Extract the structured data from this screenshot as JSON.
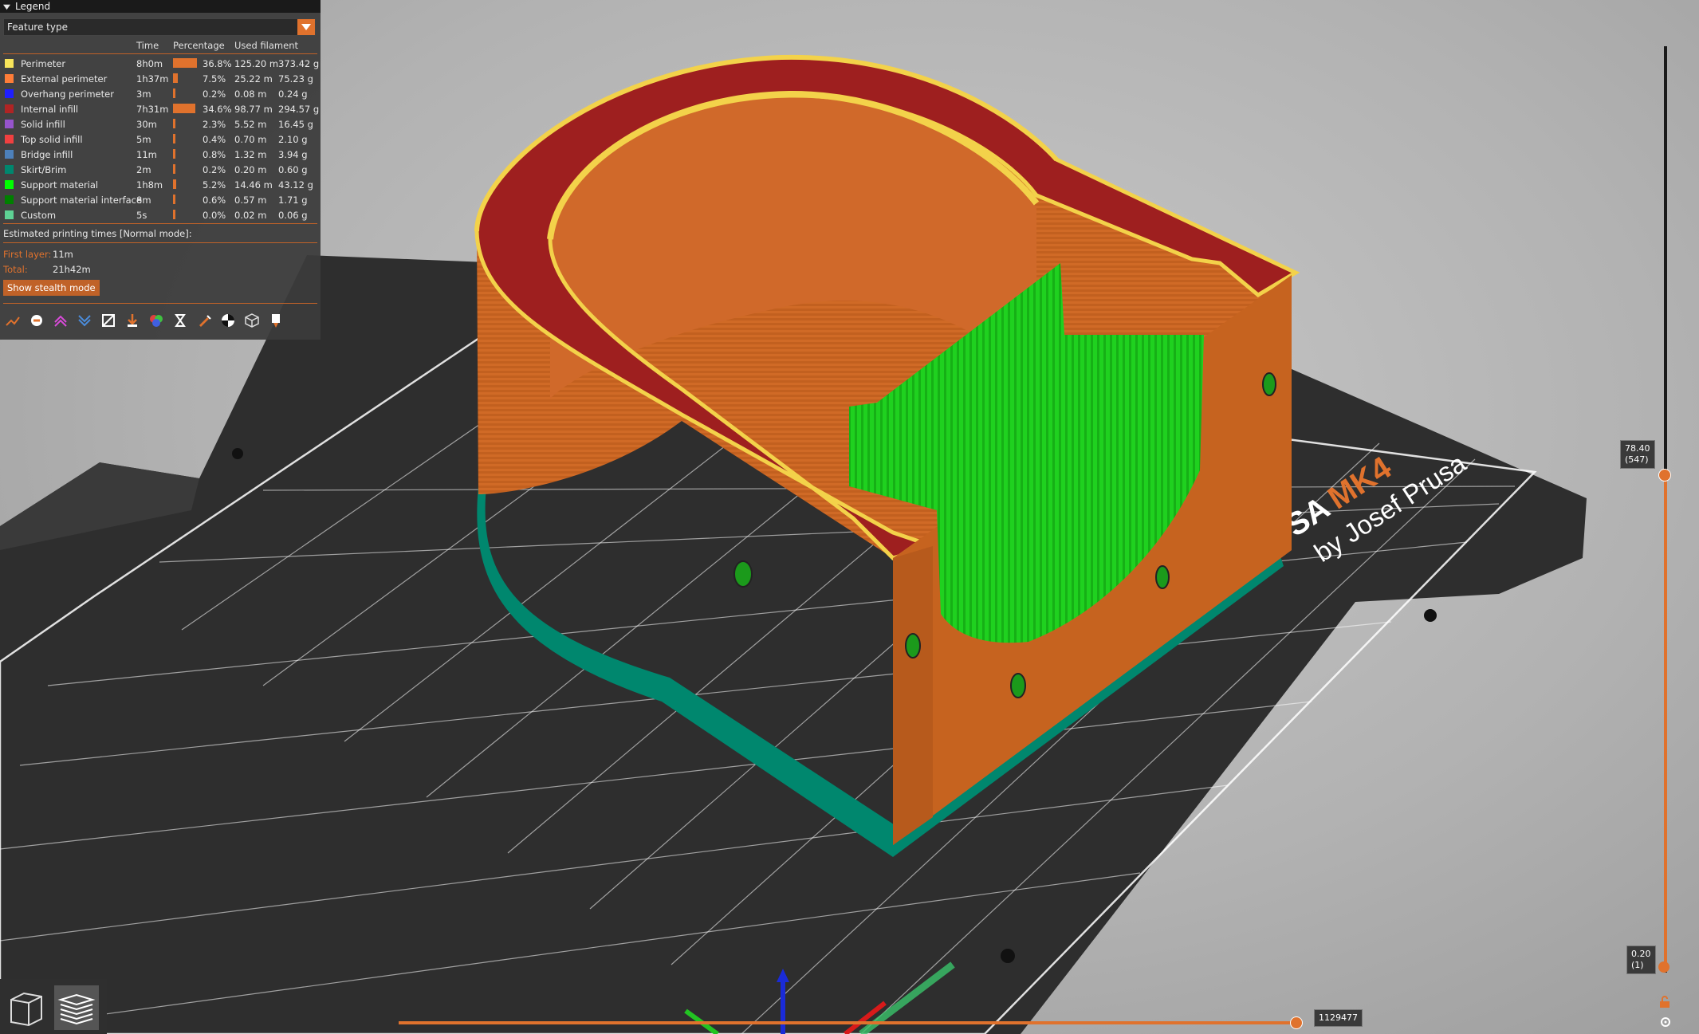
{
  "legend": {
    "title": "Legend",
    "view_type": "Feature type",
    "columns": {
      "time": "Time",
      "percentage": "Percentage",
      "used_filament": "Used filament"
    },
    "rows": [
      {
        "name": "Perimeter",
        "color": "#f7e45a",
        "time": "8h0m",
        "pct": "36.8%",
        "pct_value": 36.8,
        "length": "125.20 m",
        "weight": "373.42 g"
      },
      {
        "name": "External perimeter",
        "color": "#ff7d38",
        "time": "1h37m",
        "pct": "7.5%",
        "pct_value": 7.5,
        "length": "25.22 m",
        "weight": "75.23 g"
      },
      {
        "name": "Overhang perimeter",
        "color": "#1f1fff",
        "time": "3m",
        "pct": "0.2%",
        "pct_value": 0.2,
        "length": "0.08 m",
        "weight": "0.24 g"
      },
      {
        "name": "Internal infill",
        "color": "#b02424",
        "time": "7h31m",
        "pct": "34.6%",
        "pct_value": 34.6,
        "length": "98.77 m",
        "weight": "294.57 g"
      },
      {
        "name": "Solid infill",
        "color": "#9654cc",
        "time": "30m",
        "pct": "2.3%",
        "pct_value": 2.3,
        "length": "5.52 m",
        "weight": "16.45 g"
      },
      {
        "name": "Top solid infill",
        "color": "#f04040",
        "time": "5m",
        "pct": "0.4%",
        "pct_value": 0.4,
        "length": "0.70 m",
        "weight": "2.10 g"
      },
      {
        "name": "Bridge infill",
        "color": "#4d80ba",
        "time": "11m",
        "pct": "0.8%",
        "pct_value": 0.8,
        "length": "1.32 m",
        "weight": "3.94 g"
      },
      {
        "name": "Skirt/Brim",
        "color": "#00876e",
        "time": "2m",
        "pct": "0.2%",
        "pct_value": 0.2,
        "length": "0.20 m",
        "weight": "0.60 g"
      },
      {
        "name": "Support material",
        "color": "#00ff00",
        "time": "1h8m",
        "pct": "5.2%",
        "pct_value": 5.2,
        "length": "14.46 m",
        "weight": "43.12 g"
      },
      {
        "name": "Support material interface",
        "color": "#008000",
        "time": "8m",
        "pct": "0.6%",
        "pct_value": 0.6,
        "length": "0.57 m",
        "weight": "1.71 g"
      },
      {
        "name": "Custom",
        "color": "#5ed194",
        "time": "5s",
        "pct": "0.0%",
        "pct_value": 0.0,
        "length": "0.02 m",
        "weight": "0.06 g"
      }
    ],
    "estimated_label": "Estimated printing times [Normal mode]:",
    "first_layer_label": "First layer:",
    "first_layer_value": "11m",
    "total_label": "Total:",
    "total_value": "21h42m",
    "stealth_button": "Show stealth mode",
    "toolbar_icons": [
      "travel-icon",
      "wipe-icon",
      "retractions-icon",
      "deretractions-icon",
      "seams-icon",
      "tool-changes-icon",
      "color-changes-icon",
      "pause-prints-icon",
      "custom-gcodes-icon",
      "center-of-gravity-icon",
      "shells-icon",
      "tool-marker-icon"
    ]
  },
  "layers_slider": {
    "top_value": "78.40",
    "top_layer": "(547)",
    "bottom_value": "0.20",
    "bottom_layer": "(1)",
    "top_fraction": 1.0,
    "bottom_fraction": 0.0
  },
  "moves_slider": {
    "value": "1129477",
    "fraction": 1.0
  },
  "bed": {
    "brand_prefix": "USA",
    "brand_model": "MK4",
    "brand_byline": "by Josef Prusa"
  },
  "colors": {
    "accent": "#e0722d",
    "bed": "#2e2e2e",
    "grid": "#ffffff"
  }
}
